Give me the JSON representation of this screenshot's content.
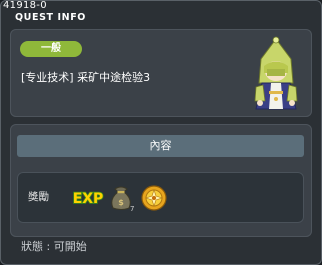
{
  "header": {
    "quest_id": "41918-0",
    "title": "QUEST INFO"
  },
  "quest": {
    "category": "一般",
    "name": "[专业技术] 采矿中途检验3"
  },
  "content": {
    "section_title": "內容"
  },
  "rewards": {
    "label": "獎勵",
    "items": [
      {
        "icon": "exp-icon",
        "text": "EXP"
      },
      {
        "icon": "money-bag-icon"
      },
      {
        "icon": "medal-icon"
      }
    ]
  },
  "status": "狀態 : 可開始",
  "colors": {
    "badge": "#8fb83a",
    "section_bar": "#5b6e7a",
    "exp_yellow": "#ffd200",
    "exp_green": "#3a8c1a"
  }
}
